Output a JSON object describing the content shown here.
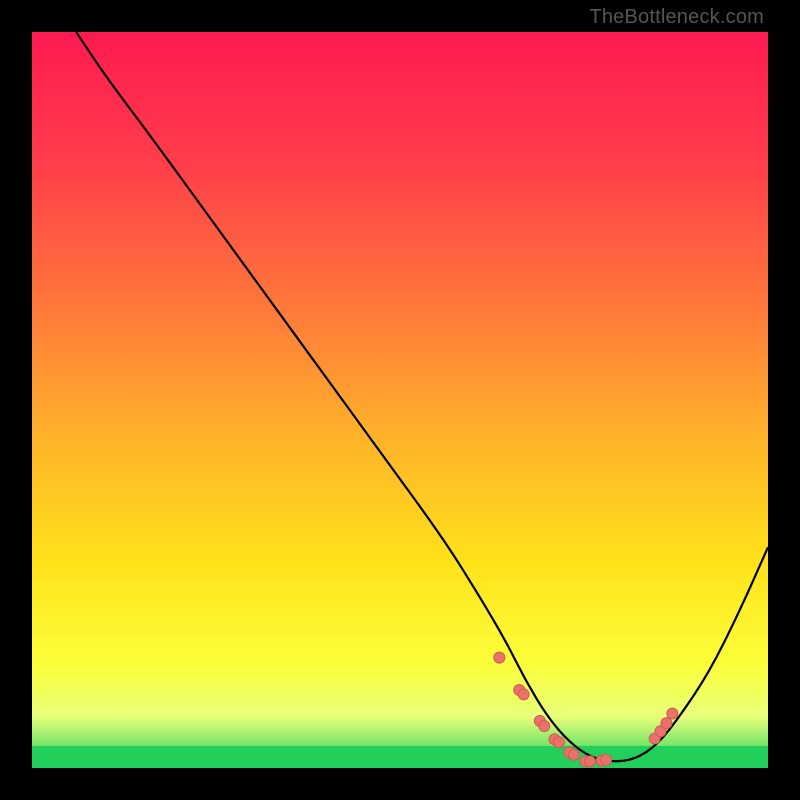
{
  "watermark": "TheBottleneck.com",
  "colors": {
    "frame": "#000000",
    "curve": "#000000",
    "dots_fill": "#e9736a",
    "dots_stroke": "#d45a50",
    "bottom_band": "#22cf5a"
  },
  "gradient_stops": [
    {
      "offset": 0.0,
      "color": "#ff1a52"
    },
    {
      "offset": 0.18,
      "color": "#ff3e4a"
    },
    {
      "offset": 0.38,
      "color": "#ff7a3a"
    },
    {
      "offset": 0.55,
      "color": "#ffb22a"
    },
    {
      "offset": 0.72,
      "color": "#ffe21a"
    },
    {
      "offset": 0.86,
      "color": "#fbff3a"
    },
    {
      "offset": 0.93,
      "color": "#e8ff7a"
    },
    {
      "offset": 1.0,
      "color": "#22cf5a"
    }
  ],
  "chart_data": {
    "type": "line",
    "title": "",
    "xlabel": "",
    "ylabel": "",
    "xlim": [
      0,
      100
    ],
    "ylim": [
      0,
      100
    ],
    "curve": {
      "x": [
        6,
        10,
        16,
        24,
        32,
        40,
        48,
        56,
        61,
        64.5,
        67,
        70,
        73,
        76,
        79,
        82,
        85,
        88,
        92,
        96,
        100
      ],
      "y": [
        100,
        94,
        86,
        75,
        64,
        53,
        42,
        31,
        23,
        17,
        12,
        7,
        3.5,
        1.4,
        0.8,
        1.2,
        3.2,
        7,
        13,
        21,
        30
      ]
    },
    "dots": {
      "x": [
        63.5,
        66.2,
        66.8,
        69.0,
        69.6,
        71.0,
        71.6,
        73.0,
        73.6,
        75.2,
        75.8,
        77.4,
        78.0,
        84.6,
        85.4,
        86.2,
        87.0
      ],
      "y": [
        15.0,
        10.6,
        10.0,
        6.4,
        5.7,
        3.9,
        3.5,
        2.1,
        1.8,
        0.9,
        0.9,
        1.0,
        1.1,
        4.0,
        5.0,
        6.1,
        7.4
      ]
    },
    "optimal_band_y": [
      0,
      3
    ]
  }
}
